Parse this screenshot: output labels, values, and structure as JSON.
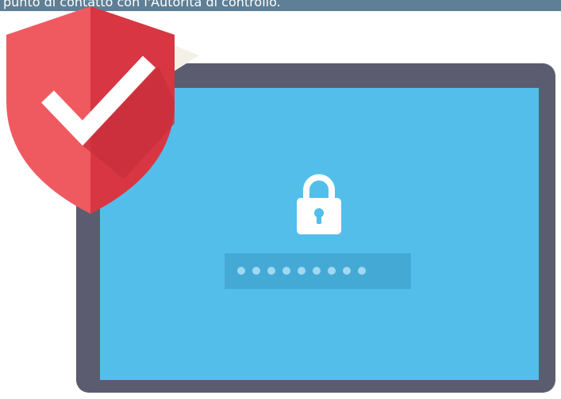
{
  "caption": "punto di contatto con l'Autorità di controllo.",
  "icons": {
    "shield": "shield-check-icon",
    "lock": "padlock-icon"
  },
  "password_field": {
    "masked_length": 9
  },
  "colors": {
    "caption_bar": "#5e7f95",
    "monitor_frame": "#5b5c6f",
    "screen": "#53beea",
    "password_field": "#45a9d6",
    "shield_light": "#ef5a60",
    "shield_dark": "#d73642",
    "check": "#ffffff"
  }
}
